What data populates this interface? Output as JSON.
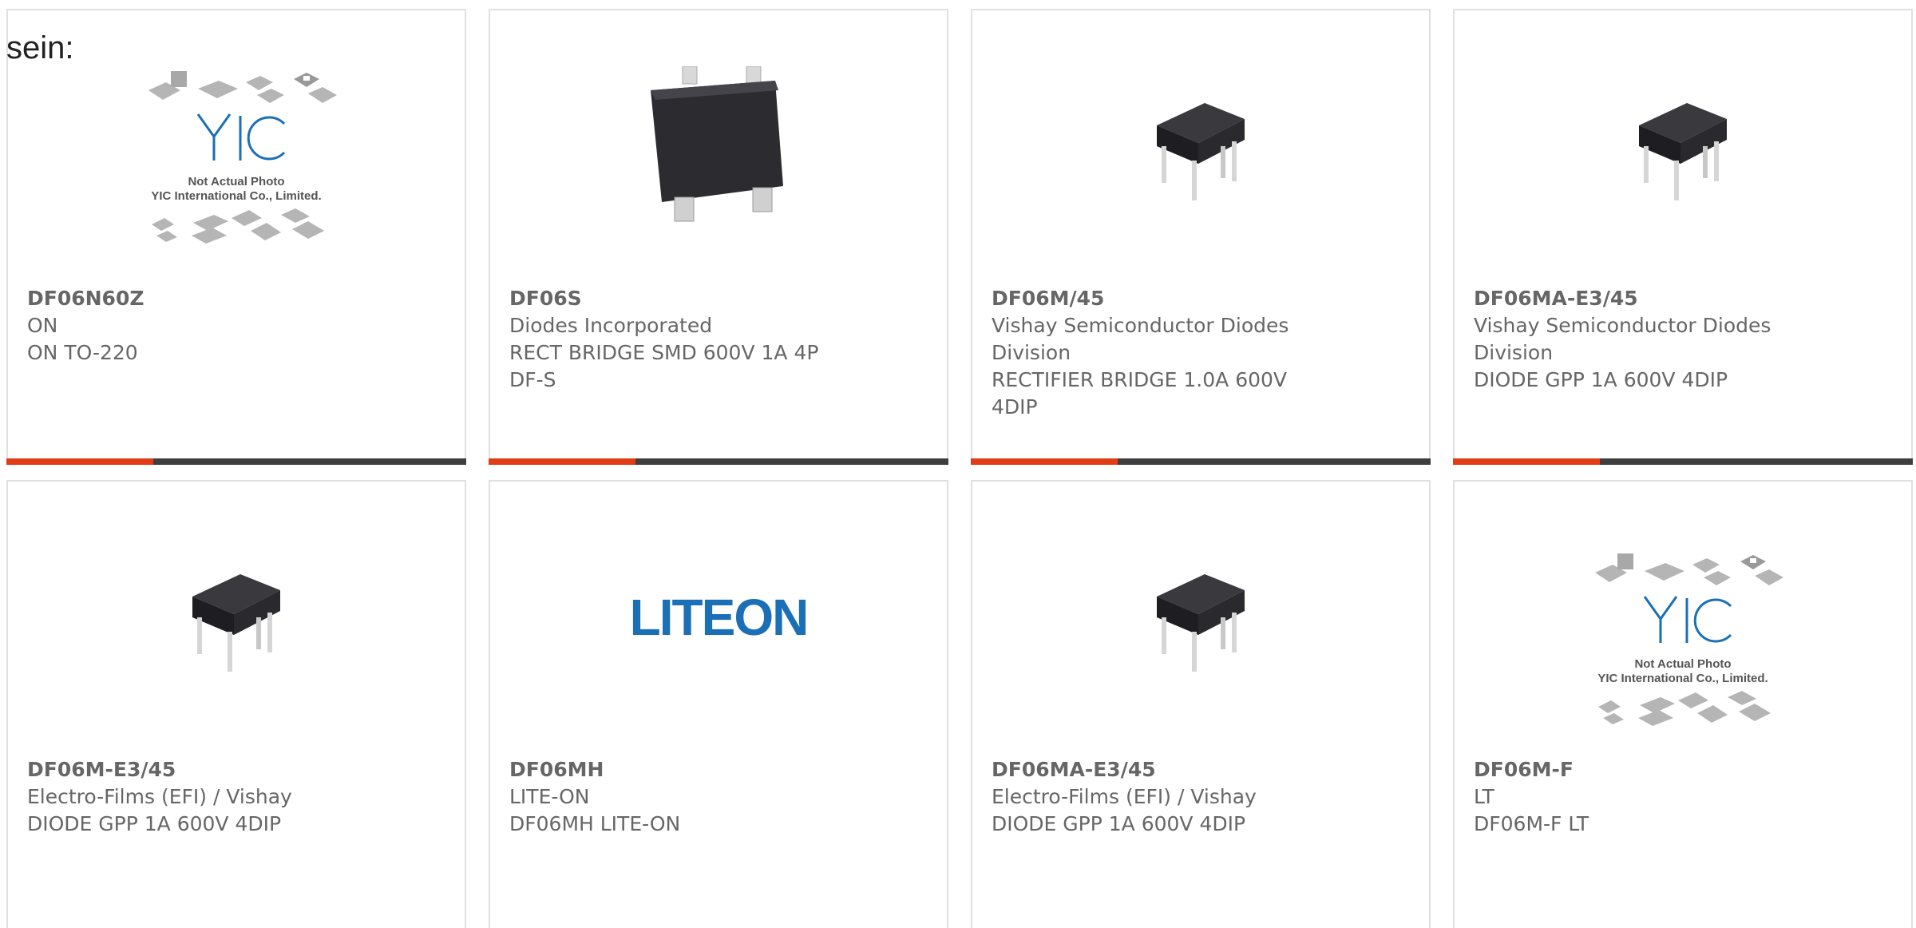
{
  "intro_text": "sein:",
  "colors": {
    "accent": "#e23c16",
    "bar": "#3e3e3e",
    "text": "#666666",
    "border": "#e0e0e0",
    "liteon_blue": "#1a6fb6"
  },
  "products": [
    {
      "part": "DF06N60Z",
      "lines": [
        "ON",
        "ON TO-220"
      ],
      "image": "placeholder-yic-icon",
      "placeholder_caption": [
        "Not Actual Photo",
        "YIC International Co., Limited."
      ]
    },
    {
      "part": "DF06S",
      "lines": [
        "Diodes Incorporated",
        "RECT BRIDGE SMD 600V 1A 4P",
        "DF-S"
      ],
      "image": "smd-bridge-chip-icon"
    },
    {
      "part": "DF06M/45",
      "lines": [
        "Vishay Semiconductor Diodes",
        "Division",
        "RECTIFIER BRIDGE 1.0A 600V",
        "4DIP"
      ],
      "image": "dip-chip-icon"
    },
    {
      "part": "DF06MA-E3/45",
      "lines": [
        "Vishay Semiconductor Diodes",
        "Division",
        "DIODE GPP 1A 600V 4DIP"
      ],
      "image": "dip-chip-icon"
    },
    {
      "part": "DF06M-E3/45",
      "lines": [
        "Electro-Films (EFI) / Vishay",
        "DIODE GPP 1A 600V 4DIP"
      ],
      "image": "dip-chip-icon"
    },
    {
      "part": "DF06MH",
      "lines": [
        "LITE-ON",
        "DF06MH LITE-ON"
      ],
      "image": "liteon-logo",
      "logo_text": "LITEON"
    },
    {
      "part": "DF06MA-E3/45",
      "lines": [
        "Electro-Films (EFI) / Vishay",
        "DIODE GPP 1A 600V 4DIP"
      ],
      "image": "dip-chip-icon"
    },
    {
      "part": "DF06M-F",
      "lines": [
        "LT",
        "DF06M-F LT"
      ],
      "image": "placeholder-yic-icon",
      "placeholder_caption": [
        "Not Actual Photo",
        "YIC International Co., Limited."
      ]
    }
  ]
}
